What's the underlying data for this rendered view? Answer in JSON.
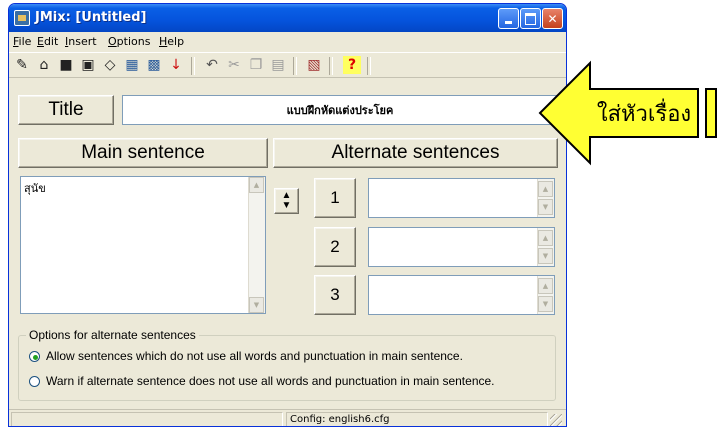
{
  "window": {
    "title": "JMix: [Untitled]",
    "icons": [
      "app-icon",
      "minimize-icon",
      "maximize-icon",
      "close-icon"
    ]
  },
  "menu": [
    {
      "accel": "F",
      "rest": "ile"
    },
    {
      "accel": "E",
      "rest": "dit"
    },
    {
      "accel": "I",
      "rest": "nsert"
    },
    {
      "accel": "O",
      "rest": "ptions"
    },
    {
      "accel": "H",
      "rest": "elp"
    }
  ],
  "toolbar": {
    "icons": [
      "new-icon",
      "open-icon",
      "save-icon",
      "save-as-icon",
      "clear-icon",
      "export-icon",
      "export-web-icon",
      "arrow-down-icon",
      "undo-icon",
      "cut-icon",
      "copy-icon",
      "paste-icon",
      "config-icon",
      "help-icon"
    ]
  },
  "title_section": {
    "label": "Title",
    "value": "แบบฝึกหัดแต่งประโยค"
  },
  "main": {
    "label": "Main sentence",
    "text": "สุนัข"
  },
  "alternate": {
    "label": "Alternate sentences",
    "numbers": [
      "1",
      "2",
      "3"
    ]
  },
  "options": {
    "legend": "Options for alternate sentences",
    "allow": "Allow sentences which do not use all words and punctuation in main sentence.",
    "warn": "Warn if alternate sentence does not use all words and punctuation in main sentence.",
    "selected": "allow"
  },
  "status": {
    "config": "Config: english6.cfg"
  },
  "callout": {
    "text": "ใส่หัวเรื่อง",
    "color": "#ffff33"
  }
}
